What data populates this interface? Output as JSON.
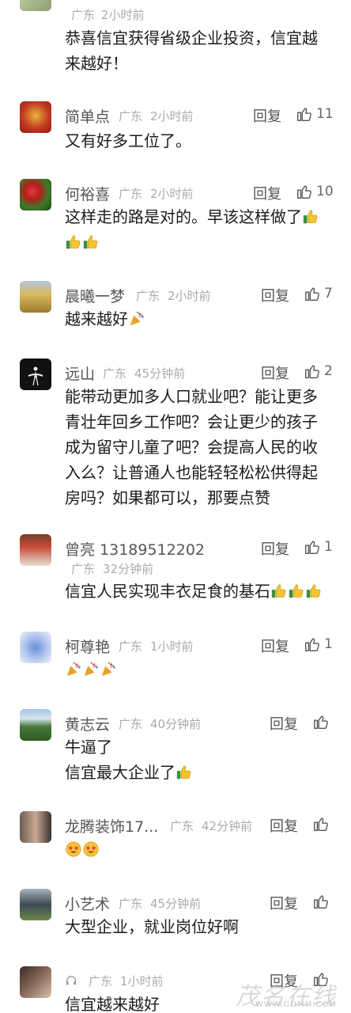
{
  "comments": [
    {
      "name": "",
      "location": "广东",
      "time": "2小时前",
      "reply": "",
      "likes": "",
      "lines": [
        "恭喜信宜获得省级企业投资，信宜越",
        "来越好！"
      ]
    },
    {
      "name": "简单点",
      "location": "广东",
      "time": "2小时前",
      "reply": "回复",
      "likes": "11",
      "lines": [
        "又有好多工位了。"
      ]
    },
    {
      "name": "何裕喜",
      "location": "广东",
      "time": "2小时前",
      "reply": "回复",
      "likes": "10",
      "lines": [
        "这样走的路是对的。早该这样做了"
      ]
    },
    {
      "name": "晨曦一梦",
      "location": "广东",
      "time": "2小时前",
      "reply": "回复",
      "likes": "7",
      "lines": [
        "越来越好"
      ]
    },
    {
      "name": "远山",
      "location": "广东",
      "time": "45分钟前",
      "reply": "回复",
      "likes": "2",
      "lines": [
        "能带动更加多人口就业吧？能让更多",
        "青壮年回乡工作吧？会让更少的孩子",
        "成为留守儿童了吧？会提高人民的收",
        "入么？让普通人也能轻轻松松供得起",
        "房吗？如果都可以，那要点赞"
      ]
    },
    {
      "name": "曾亮 13189512202",
      "location": "广东",
      "time": "32分钟前",
      "reply": "回复",
      "likes": "1",
      "lines": [
        "信宜人民实现丰衣足食的基石"
      ]
    },
    {
      "name": "柯尊艳",
      "location": "广东",
      "time": "1小时前",
      "reply": "回复",
      "likes": "1",
      "lines": [
        ""
      ]
    },
    {
      "name": "黄志云",
      "location": "广东",
      "time": "40分钟前",
      "reply": "回复",
      "likes": "",
      "lines": [
        "牛逼了",
        "信宜最大企业了"
      ]
    },
    {
      "name": "龙腾装饰17...",
      "location": "广东",
      "time": "42分钟前",
      "reply": "回复",
      "likes": "",
      "lines": [
        ""
      ]
    },
    {
      "name": "小艺术",
      "location": "广东",
      "time": "45分钟前",
      "reply": "回复",
      "likes": "",
      "lines": [
        "大型企业，就业岗位好啊"
      ]
    },
    {
      "name": "",
      "location": "广东",
      "time": "1小时前",
      "reply": "回复",
      "likes": "",
      "lines": [
        "信宜越来越好"
      ]
    }
  ],
  "watermark": {
    "main": "茂名在线",
    "url": "WWW.GDMM.COM"
  },
  "icons": {
    "like": "thumbs-up-icon",
    "thumbs_emoji": "thumbs-up-emoji",
    "party": "party-popper-emoji",
    "star_eyes": "star-struck-emoji"
  },
  "colors": {
    "text": "#1b1b1b",
    "meta": "#aaaaaa",
    "name": "#555555"
  }
}
